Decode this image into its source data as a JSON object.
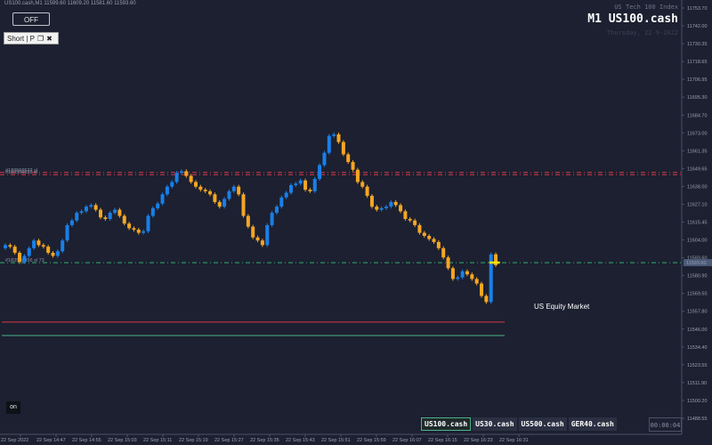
{
  "window": {
    "info_line": "US100.cash,M1  11599.60 11609.20 11581.60 11593.60",
    "symbol_title": "M1 US100.cash",
    "symbol_desc": "US Tech 100 Index",
    "date_text": "Thursday, 22-9-2022",
    "market_label": "US Equity Market",
    "timer": "00:00:04"
  },
  "controls": {
    "off_label": "OFF",
    "on_label": "on",
    "short_panel": {
      "label": "Short | P",
      "icons": [
        "restore-icon",
        "close-icon"
      ]
    }
  },
  "tabs": [
    {
      "label": "US100.cash",
      "active": true
    },
    {
      "label": "US30.cash",
      "active": false
    },
    {
      "label": "US500.cash",
      "active": false
    },
    {
      "label": "GER40.cash",
      "active": false
    }
  ],
  "price_axis": {
    "labels": [
      "11753.70",
      "11742.00",
      "11730.35",
      "11718.65",
      "11706.95",
      "11695.30",
      "11684.70",
      "11673.00",
      "11661.35",
      "11649.65",
      "11638.00",
      "11627.10",
      "11615.45",
      "11604.00",
      "11593.60",
      "11580.90",
      "11569.50",
      "11557.80",
      "11546.00",
      "11534.40",
      "11523.55",
      "11511.90",
      "11500.20",
      "11488.55"
    ],
    "current_price": "11593.60"
  },
  "time_axis": {
    "labels": [
      "22 Sep 2022",
      "22 Sep 14:47",
      "22 Sep 14:55",
      "22 Sep 15:03",
      "22 Sep 15:11",
      "22 Sep 15:19",
      "22 Sep 15:27",
      "22 Sep 15:35",
      "22 Sep 15:43",
      "22 Sep 15:51",
      "22 Sep 15:59",
      "22 Sep 16:07",
      "22 Sep 16:15",
      "22 Sep 16:23",
      "22 Sep 16:31"
    ]
  },
  "order_lines": [
    {
      "label": "#183566522 sl",
      "price": 11652.2,
      "color": "#d9394a"
    },
    {
      "label": "#183566522 sl",
      "price": 11650.8,
      "color": "#d9394a"
    },
    {
      "label": "#183566856 sl 73",
      "price": 11593.6,
      "color": "#2fae74"
    }
  ],
  "level_lines": [
    {
      "price": 11555.0,
      "color": "#d9394a"
    },
    {
      "price": 11546.2,
      "color": "#4ab38a"
    }
  ],
  "chart_data": {
    "type": "candlestick",
    "title": "M1 US100.cash",
    "xlabel": "",
    "ylabel": "",
    "ylim": [
      11482,
      11762
    ],
    "grid": false,
    "colors": {
      "up": "#1a7fe8",
      "down": "#f5a623",
      "current_marker": "#ffe600"
    },
    "close": [
      11605,
      11604,
      11600,
      11594,
      11598,
      11603,
      11608,
      11605,
      11604,
      11600,
      11598,
      11601,
      11608,
      11618,
      11621,
      11626,
      11627,
      11630,
      11631,
      11628,
      11623,
      11622,
      11626,
      11628,
      11624,
      11619,
      11616,
      11615,
      11613,
      11614,
      11624,
      11629,
      11632,
      11638,
      11643,
      11646,
      11652,
      11653,
      11650,
      11646,
      11643,
      11641,
      11640,
      11638,
      11633,
      11630,
      11635,
      11640,
      11643,
      11638,
      11624,
      11617,
      11610,
      11608,
      11605,
      11618,
      11626,
      11630,
      11636,
      11639,
      11644,
      11645,
      11647,
      11641,
      11640,
      11648,
      11657,
      11665,
      11676,
      11677,
      11672,
      11664,
      11659,
      11654,
      11646,
      11643,
      11637,
      11630,
      11628,
      11629,
      11630,
      11633,
      11631,
      11627,
      11622,
      11621,
      11618,
      11613,
      11611,
      11609,
      11607,
      11603,
      11597,
      11590,
      11583,
      11584,
      11588,
      11586,
      11583,
      11580,
      11572,
      11568,
      11599,
      11592
    ]
  }
}
